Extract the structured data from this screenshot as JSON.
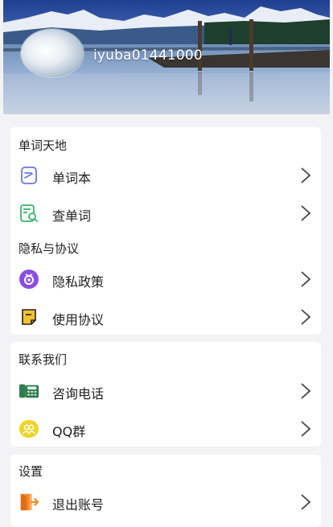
{
  "profile": {
    "username": "iyuba01441000"
  },
  "sections": [
    {
      "title": "单词天地",
      "items": [
        {
          "label": "单词本",
          "icon": "notebook-icon"
        },
        {
          "label": "查单词",
          "icon": "lookup-word-icon"
        }
      ]
    },
    {
      "title": "隐私与协议",
      "items": [
        {
          "label": "隐私政策",
          "icon": "privacy-icon"
        },
        {
          "label": "使用协议",
          "icon": "agreement-icon"
        }
      ]
    },
    {
      "title": "联系我们",
      "items": [
        {
          "label": "咨询电话",
          "icon": "phone-icon"
        },
        {
          "label": "QQ群",
          "icon": "qq-group-icon"
        }
      ]
    },
    {
      "title": "设置",
      "items": [
        {
          "label": "退出账号",
          "icon": "logout-icon"
        }
      ]
    }
  ],
  "colors": {
    "notebook": "#6b7bd8",
    "lookup": "#3bb26a",
    "privacy": "#8a4fe0",
    "agreement": "#f2c230",
    "phone": "#2f7d4f",
    "qq": "#f0d42a",
    "logout": "#f28a2b"
  }
}
